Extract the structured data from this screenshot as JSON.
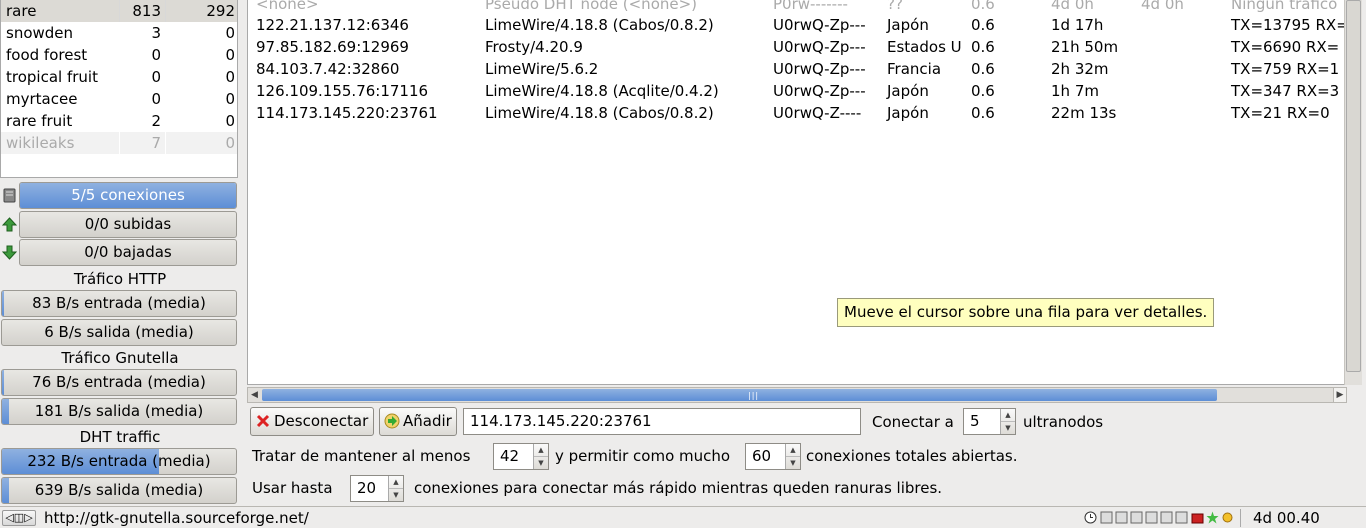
{
  "searches": [
    {
      "name": "rare",
      "a": "813",
      "b": "292"
    },
    {
      "name": "snowden",
      "a": "3",
      "b": "0"
    },
    {
      "name": "food forest",
      "a": "0",
      "b": "0"
    },
    {
      "name": "tropical fruit",
      "a": "0",
      "b": "0"
    },
    {
      "name": "myrtacee",
      "a": "0",
      "b": "0"
    },
    {
      "name": "rare fruit",
      "a": "2",
      "b": "0"
    },
    {
      "name": "wikileaks",
      "a": "7",
      "b": "0"
    }
  ],
  "stats": {
    "connections": {
      "label": "5/5 conexiones",
      "fill": 1.0
    },
    "uploads": {
      "label": "0/0 subidas",
      "fill": 0
    },
    "downloads": {
      "label": "0/0 bajadas",
      "fill": 0
    },
    "http_title": "Tráfico HTTP",
    "http_in": {
      "label": "83 B/s entrada (media)",
      "fill": 0.01
    },
    "http_out": {
      "label": "6 B/s salida (media)",
      "fill": 0
    },
    "gnutella_title": "Tráfico Gnutella",
    "gnutella_in": {
      "label": "76 B/s entrada (media)",
      "fill": 0.01
    },
    "gnutella_out": {
      "label": "181 B/s salida (media)",
      "fill": 0.03
    },
    "dht_title": "DHT traffic",
    "dht_in": {
      "label": "232 B/s entrada (media)",
      "fill": 0.67
    },
    "dht_out": {
      "label": "639 B/s salida (media)",
      "fill": 0.03
    }
  },
  "nodes_header_row": [
    "<none>",
    "Pseudo DHT node (<none>)",
    "P0rw-------",
    "??",
    "0.6",
    "4d 0h",
    "4d 0h",
    "Ningún tráfico"
  ],
  "nodes": [
    {
      "host": "122.21.137.12:6346",
      "client": "LimeWire/4.18.8 (Cabos/0.8.2)",
      "flags": "U0rwQ-Zp---",
      "country": "Japón",
      "version": "0.6",
      "uptime": "1d 17h",
      "traffic": "TX=13795 RX="
    },
    {
      "host": "97.85.182.69:12969",
      "client": "Frosty/4.20.9",
      "flags": "U0rwQ-Zp---",
      "country": "Estados U",
      "version": "0.6",
      "uptime": "21h 50m",
      "traffic": "TX=6690 RX="
    },
    {
      "host": "84.103.7.42:32860",
      "client": "LimeWire/5.6.2",
      "flags": "U0rwQ-Zp---",
      "country": "Francia",
      "version": "0.6",
      "uptime": "2h 32m",
      "traffic": "TX=759 RX=1"
    },
    {
      "host": "126.109.155.76:17116",
      "client": "LimeWire/4.18.8 (Acqlite/0.4.2)",
      "flags": "U0rwQ-Zp---",
      "country": "Japón",
      "version": "0.6",
      "uptime": "1h 7m",
      "traffic": "TX=347 RX=3"
    },
    {
      "host": "114.173.145.220:23761",
      "client": "LimeWire/4.18.8 (Cabos/0.8.2)",
      "flags": "U0rwQ-Z----",
      "country": "Japón",
      "version": "0.6",
      "uptime": "22m 13s",
      "traffic": "TX=21 RX=0"
    }
  ],
  "tooltip": "Mueve el cursor sobre una fila para ver detalles.",
  "controls": {
    "disconnect_label": "Desconectar",
    "add_label": "Añadir",
    "host_value": "114.173.145.220:23761",
    "connect_to_label": "Conectar a",
    "ultranodes_value": "5",
    "ultranodes_label": "ultranodos",
    "keep_label": "Tratar de mantener al menos",
    "keep_value": "42",
    "allow_label": "y permitir como mucho",
    "allow_value": "60",
    "total_label": "conexiones totales abiertas.",
    "use_label": "Usar hasta",
    "use_value": "20",
    "fast_label": "conexiones para conectar más rápido mientras queden ranuras libres."
  },
  "status": {
    "url": "http://gtk-gnutella.sourceforge.net/",
    "uptime": "4d 00.40"
  },
  "colors": {
    "accent": "#5d8ed6",
    "tooltip_bg": "#ffffbf",
    "disconnect_icon": "#d22",
    "add_icon": "#3a3"
  }
}
